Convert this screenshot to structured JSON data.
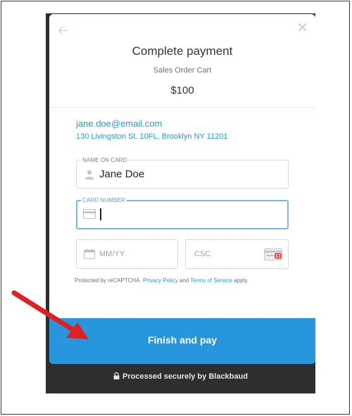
{
  "modal": {
    "title": "Complete payment",
    "subtitle": "Sales Order Cart",
    "amount": "$100"
  },
  "contact": {
    "email": "jane.doe@email.com",
    "address": "130 Livingston St. 10FL, Brooklyn NY 11201"
  },
  "form": {
    "name_label": "NAME ON CARD",
    "name_value": "Jane Doe",
    "card_label": "CARD NUMBER",
    "card_value": "",
    "expiry_placeholder": "MM/YY",
    "csc_placeholder": "CSC"
  },
  "legal": {
    "prefix": "Protected by reCAPTCHA.",
    "privacy_link": "Privacy Policy",
    "and": "and",
    "terms_link": "Terms of Service",
    "suffix": "apply."
  },
  "actions": {
    "pay_label": "Finish and pay"
  },
  "footer": {
    "secure_text": "Processed securely by Blackbaud"
  },
  "icons": {
    "back": "arrow-left-icon",
    "close": "close-icon",
    "person": "person-icon",
    "card": "credit-card-icon",
    "calendar": "calendar-icon",
    "csc": "csc-card-icon",
    "lock": "lock-icon",
    "annotation": "red-arrow-icon"
  },
  "colors": {
    "accent": "#2796dc",
    "link": "#1c9ec9",
    "focus_border": "#75b9e3",
    "annotation_arrow": "#e02020"
  }
}
